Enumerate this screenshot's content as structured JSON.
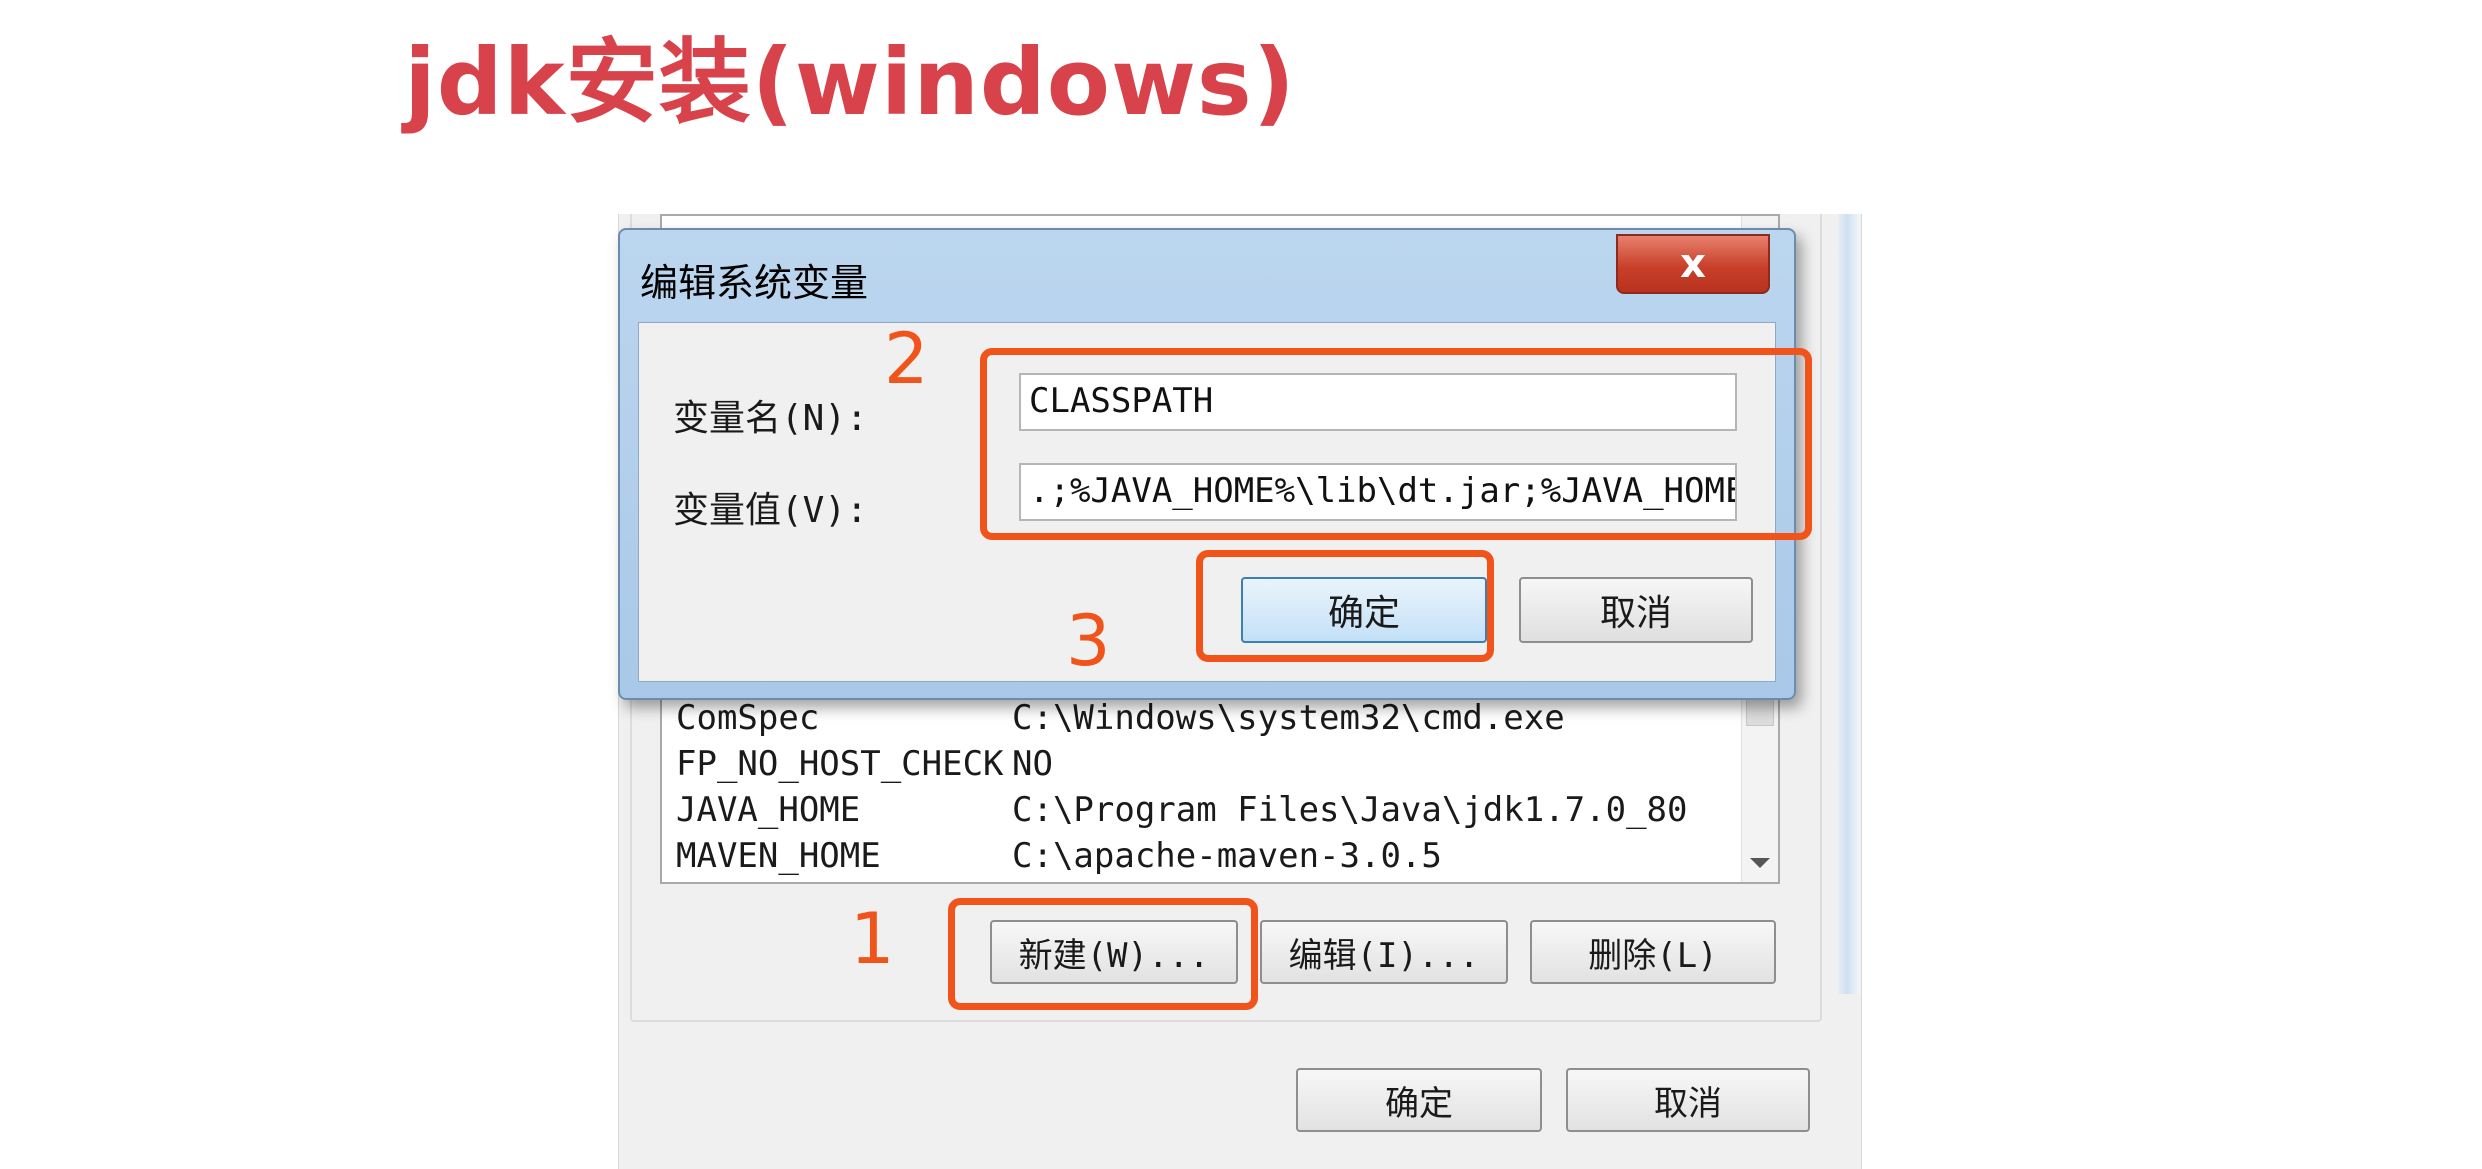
{
  "slide_title": "jdk安装(windows)",
  "dialog": {
    "title": "编辑系统变量",
    "close_symbol": "x",
    "name_label": "变量名(N):",
    "name_value": "CLASSPATH",
    "value_label": "变量值(V):",
    "value_value": ".;%JAVA_HOME%\\lib\\dt.jar;%JAVA_HOME%",
    "ok_label": "确定",
    "cancel_label": "取消"
  },
  "system_variables": {
    "rows": [
      {
        "name": "ComSpec",
        "value": "C:\\Windows\\system32\\cmd.exe"
      },
      {
        "name": "FP_NO_HOST_CHECK",
        "value": "NO"
      },
      {
        "name": "JAVA_HOME",
        "value": "C:\\Program Files\\Java\\jdk1.7.0_80"
      },
      {
        "name": "MAVEN_HOME",
        "value": "C:\\apache-maven-3.0.5"
      }
    ],
    "new_label": "新建(W)...",
    "edit_label": "编辑(I)...",
    "delete_label": "删除(L)"
  },
  "window": {
    "ok_label": "确定",
    "cancel_label": "取消"
  },
  "annotations": {
    "step1": "1",
    "step2": "2",
    "step3": "3",
    "color": "#f1541a"
  }
}
